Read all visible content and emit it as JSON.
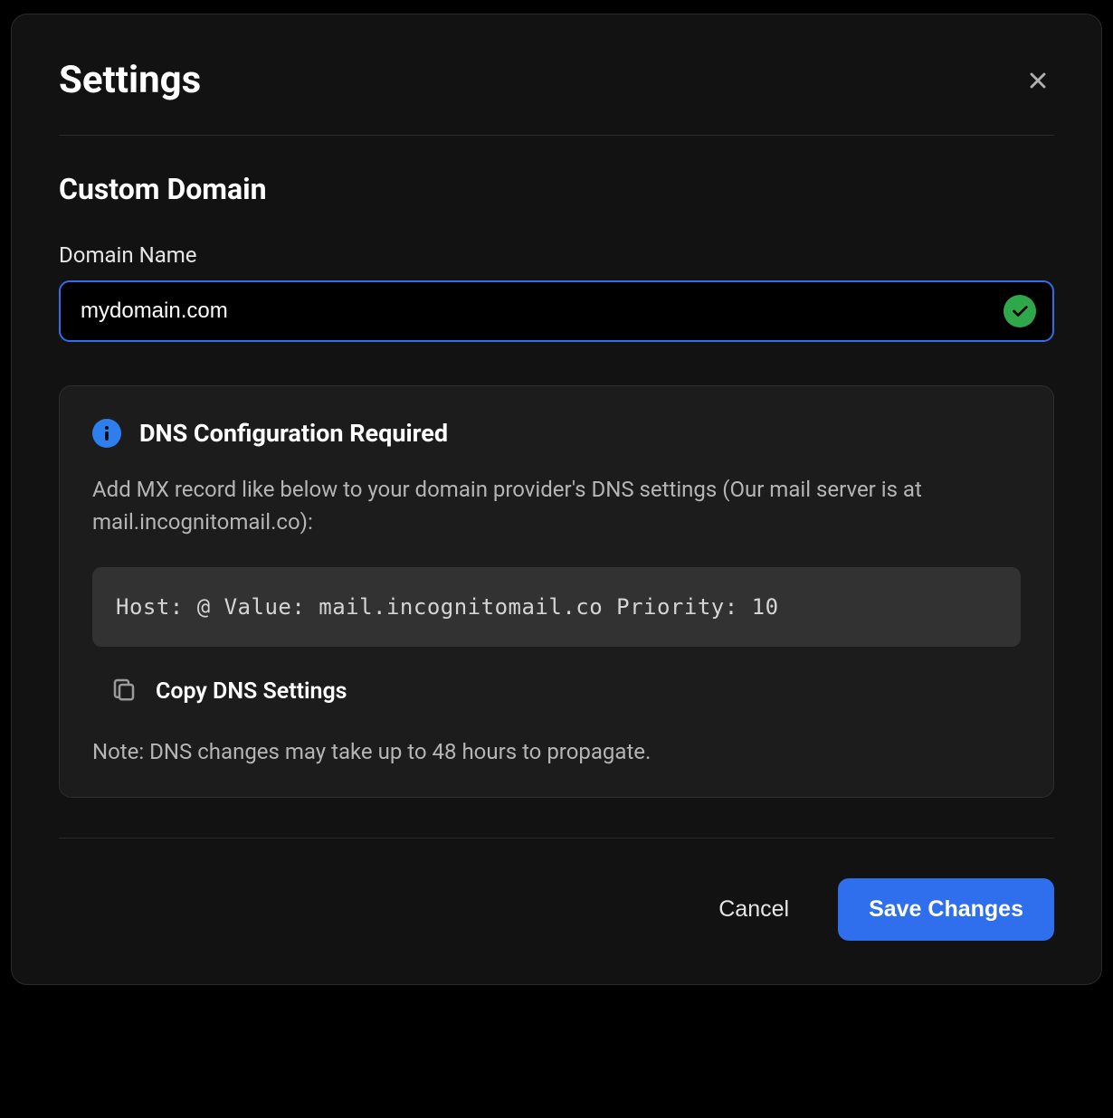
{
  "modal": {
    "title": "Settings"
  },
  "section": {
    "title": "Custom Domain",
    "domain_label": "Domain Name",
    "domain_value": "mydomain.com"
  },
  "dns": {
    "header": "DNS Configuration Required",
    "description": "Add MX record like below to your domain provider's DNS settings (Our mail server is at mail.incognitomail.co):",
    "record": "Host: @ Value: mail.incognitomail.co Priority: 10",
    "copy_label": "Copy DNS Settings",
    "note": "Note: DNS changes may take up to 48 hours to propagate."
  },
  "footer": {
    "cancel": "Cancel",
    "save": "Save Changes"
  },
  "colors": {
    "accent": "#2f6fed",
    "success": "#2fa84c",
    "info": "#2f7eed"
  }
}
